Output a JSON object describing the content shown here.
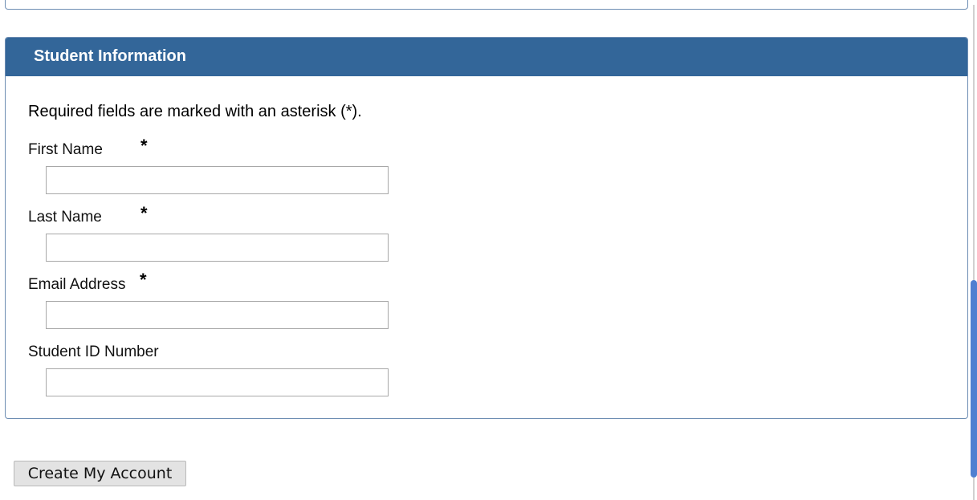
{
  "section": {
    "title": "Student Information",
    "required_note": "Required fields are marked with an asterisk (*)."
  },
  "fields": {
    "first_name": {
      "label": "First Name",
      "required_marker": "*",
      "value": ""
    },
    "last_name": {
      "label": "Last Name",
      "required_marker": "*",
      "value": ""
    },
    "email": {
      "label": "Email Address",
      "required_marker": "*",
      "value": ""
    },
    "student_id": {
      "label": "Student ID Number",
      "value": ""
    }
  },
  "actions": {
    "create_account_label": "Create My Account"
  },
  "colors": {
    "header_bg": "#336699",
    "header_text": "#ffffff",
    "panel_border": "#6d8db3",
    "scroll_thumb": "#4f7fd1"
  }
}
